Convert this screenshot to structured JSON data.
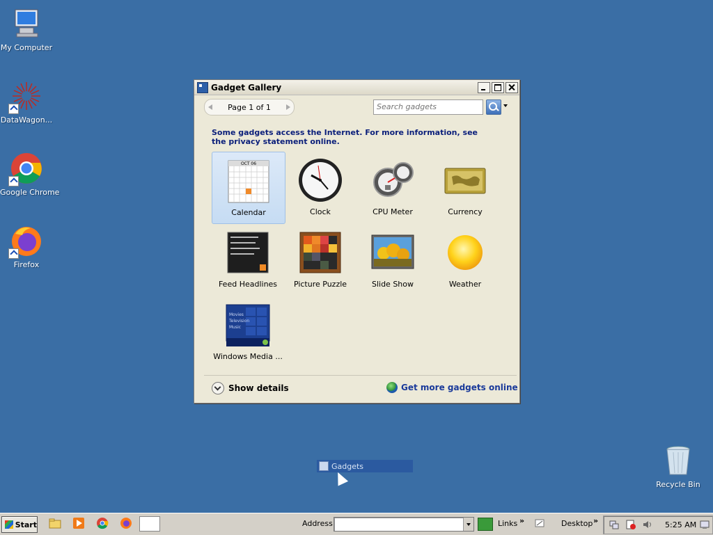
{
  "desktop": {
    "icons": [
      {
        "label": "My Computer"
      },
      {
        "label": "DataWagon..."
      },
      {
        "label": "Google Chrome"
      },
      {
        "label": "Firefox"
      },
      {
        "label": "Recycle Bin"
      }
    ]
  },
  "window": {
    "title": "Gadget Gallery",
    "pager": "Page 1 of 1",
    "search_placeholder": "Search gadgets",
    "notice": "Some gadgets access the Internet.  For more information, see the privacy statement online.",
    "gadgets": [
      {
        "label": "Calendar",
        "icon": "calendar-icon"
      },
      {
        "label": "Clock",
        "icon": "clock-icon"
      },
      {
        "label": "CPU Meter",
        "icon": "cpu-meter-icon"
      },
      {
        "label": "Currency",
        "icon": "currency-icon"
      },
      {
        "label": "Feed Headlines",
        "icon": "feed-headlines-icon"
      },
      {
        "label": "Picture Puzzle",
        "icon": "picture-puzzle-icon"
      },
      {
        "label": "Slide Show",
        "icon": "slide-show-icon"
      },
      {
        "label": "Weather",
        "icon": "weather-icon"
      },
      {
        "label": "Windows Media ...",
        "icon": "windows-media-icon"
      }
    ],
    "calendar_month": "OCT 06",
    "media_lines": [
      "Movies",
      "Television",
      "Music"
    ],
    "show_details": "Show details",
    "get_more": "Get more gadgets online"
  },
  "drag": {
    "label": "Gadgets"
  },
  "taskbar": {
    "start": "Start",
    "address_label": "Address",
    "links": "Links",
    "desktop": "Desktop",
    "chevron": "»",
    "clock": "5:25 AM"
  },
  "colors": {
    "desktop": "#3a6ea5",
    "notice_text": "#0a1e7a",
    "link_text": "#1a3a9a"
  }
}
